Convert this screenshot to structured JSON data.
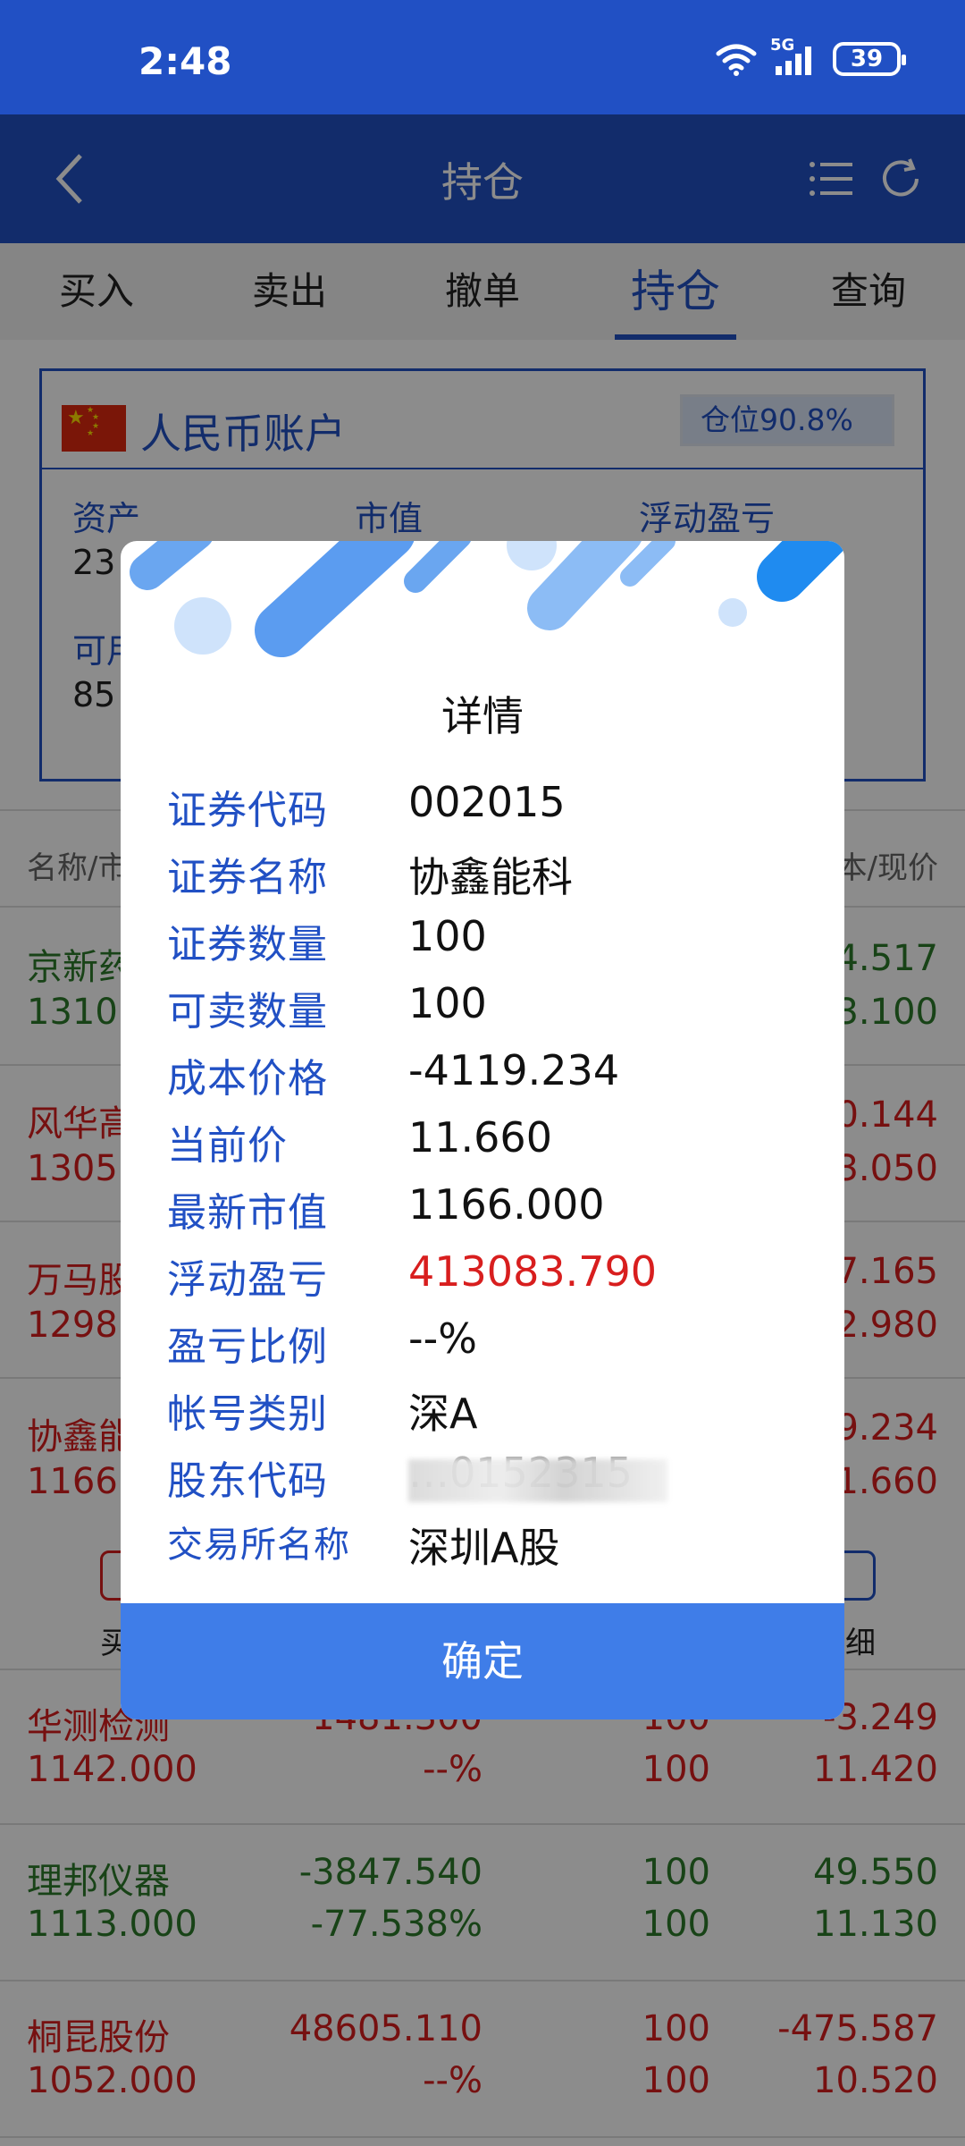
{
  "status_bar": {
    "time": "2:48",
    "network": "5G",
    "battery": "39"
  },
  "nav": {
    "title": "持仓"
  },
  "tabs": [
    "买入",
    "卖出",
    "撤单",
    "持仓",
    "查询"
  ],
  "account": {
    "title": "人民币账户",
    "position_badge": "仓位90.8%",
    "labels": {
      "assets": "资产",
      "market_value": "市值",
      "floating_pl": "浮动盈亏",
      "available": "可用"
    },
    "values": {
      "assets_partial": "23",
      "available_partial": "85"
    }
  },
  "list_header": {
    "left": "名称/市",
    "right": "本/现价"
  },
  "rows": [
    {
      "left1": "京新药",
      "left2": "1310.",
      "right1": "4.517",
      "right2": "3.100",
      "color": "green"
    },
    {
      "left1": "风华高",
      "left2": "1305.",
      "right1": "0.144",
      "right2": "3.050",
      "color": "red"
    },
    {
      "left1": "万马股",
      "left2": "1298.",
      "right1": "7.165",
      "right2": "2.980",
      "color": "red"
    },
    {
      "left1": "协鑫能",
      "left2": "1166.",
      "right1": "9.234",
      "right2": "1.660",
      "color": "red"
    }
  ],
  "action_row": {
    "left": "买",
    "right": "细"
  },
  "rows_full": [
    {
      "name": "华测检测",
      "mv": "1142.000",
      "pl": "1481.300",
      "pct": "--%",
      "qty1": "100",
      "qty2": "100",
      "cost": "-3.249",
      "price": "11.420",
      "color": "red"
    },
    {
      "name": "理邦仪器",
      "mv": "1113.000",
      "pl": "-3847.540",
      "pct": "-77.538%",
      "qty1": "100",
      "qty2": "100",
      "cost": "49.550",
      "price": "11.130",
      "color": "green"
    },
    {
      "name": "桐昆股份",
      "mv": "1052.000",
      "pl": "48605.110",
      "pct": "--%",
      "qty1": "100",
      "qty2": "100",
      "cost": "-475.587",
      "price": "10.520",
      "color": "red"
    }
  ],
  "dialog": {
    "title": "详情",
    "details": [
      {
        "label": "证券代码",
        "value": "002015"
      },
      {
        "label": "证券名称",
        "value": "协鑫能科"
      },
      {
        "label": "证券数量",
        "value": "100"
      },
      {
        "label": "可卖数量",
        "value": "100"
      },
      {
        "label": "成本价格",
        "value": "-4119.234"
      },
      {
        "label": "当前价",
        "value": "11.660"
      },
      {
        "label": "最新市值",
        "value": "1166.000"
      },
      {
        "label": "浮动盈亏",
        "value": "413083.790"
      },
      {
        "label": "盈亏比例",
        "value": "--%"
      },
      {
        "label": "帐号类别",
        "value": "深A"
      },
      {
        "label": "股东代码",
        "value": "…0152315"
      },
      {
        "label": "交易所名称",
        "value": "深圳A股"
      }
    ],
    "confirm": "确定"
  },
  "colors": {
    "primary": "#2150c4",
    "confirm": "#3f7de8",
    "loss_red": "#d81e1e",
    "gain_green": "#2d7a2b"
  }
}
